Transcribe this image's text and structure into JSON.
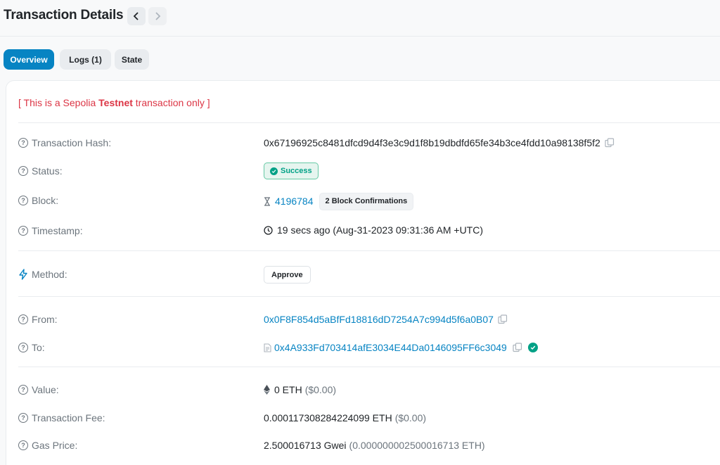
{
  "header": {
    "title": "Transaction Details",
    "prev_icon": "chevron-left-icon",
    "next_icon": "chevron-right-icon"
  },
  "tabs": [
    {
      "label": "Overview",
      "active": true
    },
    {
      "label": "Logs (1)",
      "active": false
    },
    {
      "label": "State",
      "active": false
    }
  ],
  "notice": {
    "open": "[ This is a Sepolia ",
    "bold": "Testnet",
    "close": " transaction only ]"
  },
  "rows": {
    "tx_hash": {
      "label": "Transaction Hash:",
      "value": "0x67196925c8481dfcd9d4f3e3c9d1f8b19dbdfd65fe34b3ce4fdd10a98138f5f2"
    },
    "status": {
      "label": "Status:",
      "value": "Success"
    },
    "block": {
      "label": "Block:",
      "value": "4196784",
      "confirmations": "2 Block Confirmations"
    },
    "timestamp": {
      "label": "Timestamp:",
      "value": "19 secs ago (Aug-31-2023 09:31:36 AM +UTC)"
    },
    "method": {
      "label": "Method:",
      "value": "Approve"
    },
    "from": {
      "label": "From:",
      "value": "0x0F8F854d5aBfFd18816dD7254A7c994d5f6a0B07"
    },
    "to": {
      "label": "To:",
      "value": "0x4A933Fd703414afE3034E44Da0146095FF6c3049"
    },
    "value": {
      "label": "Value:",
      "amount": "0 ETH",
      "usd": "($0.00)"
    },
    "fee": {
      "label": "Transaction Fee:",
      "amount": "0.000117308284224099 ETH",
      "usd": "($0.00)"
    },
    "gas_price": {
      "label": "Gas Price:",
      "amount": "2.500016713 Gwei",
      "eth": "(0.000000002500016713 ETH)"
    }
  },
  "colors": {
    "accent": "#0784c3",
    "success": "#00a186",
    "danger": "#dc3545",
    "muted": "#6c757d"
  }
}
